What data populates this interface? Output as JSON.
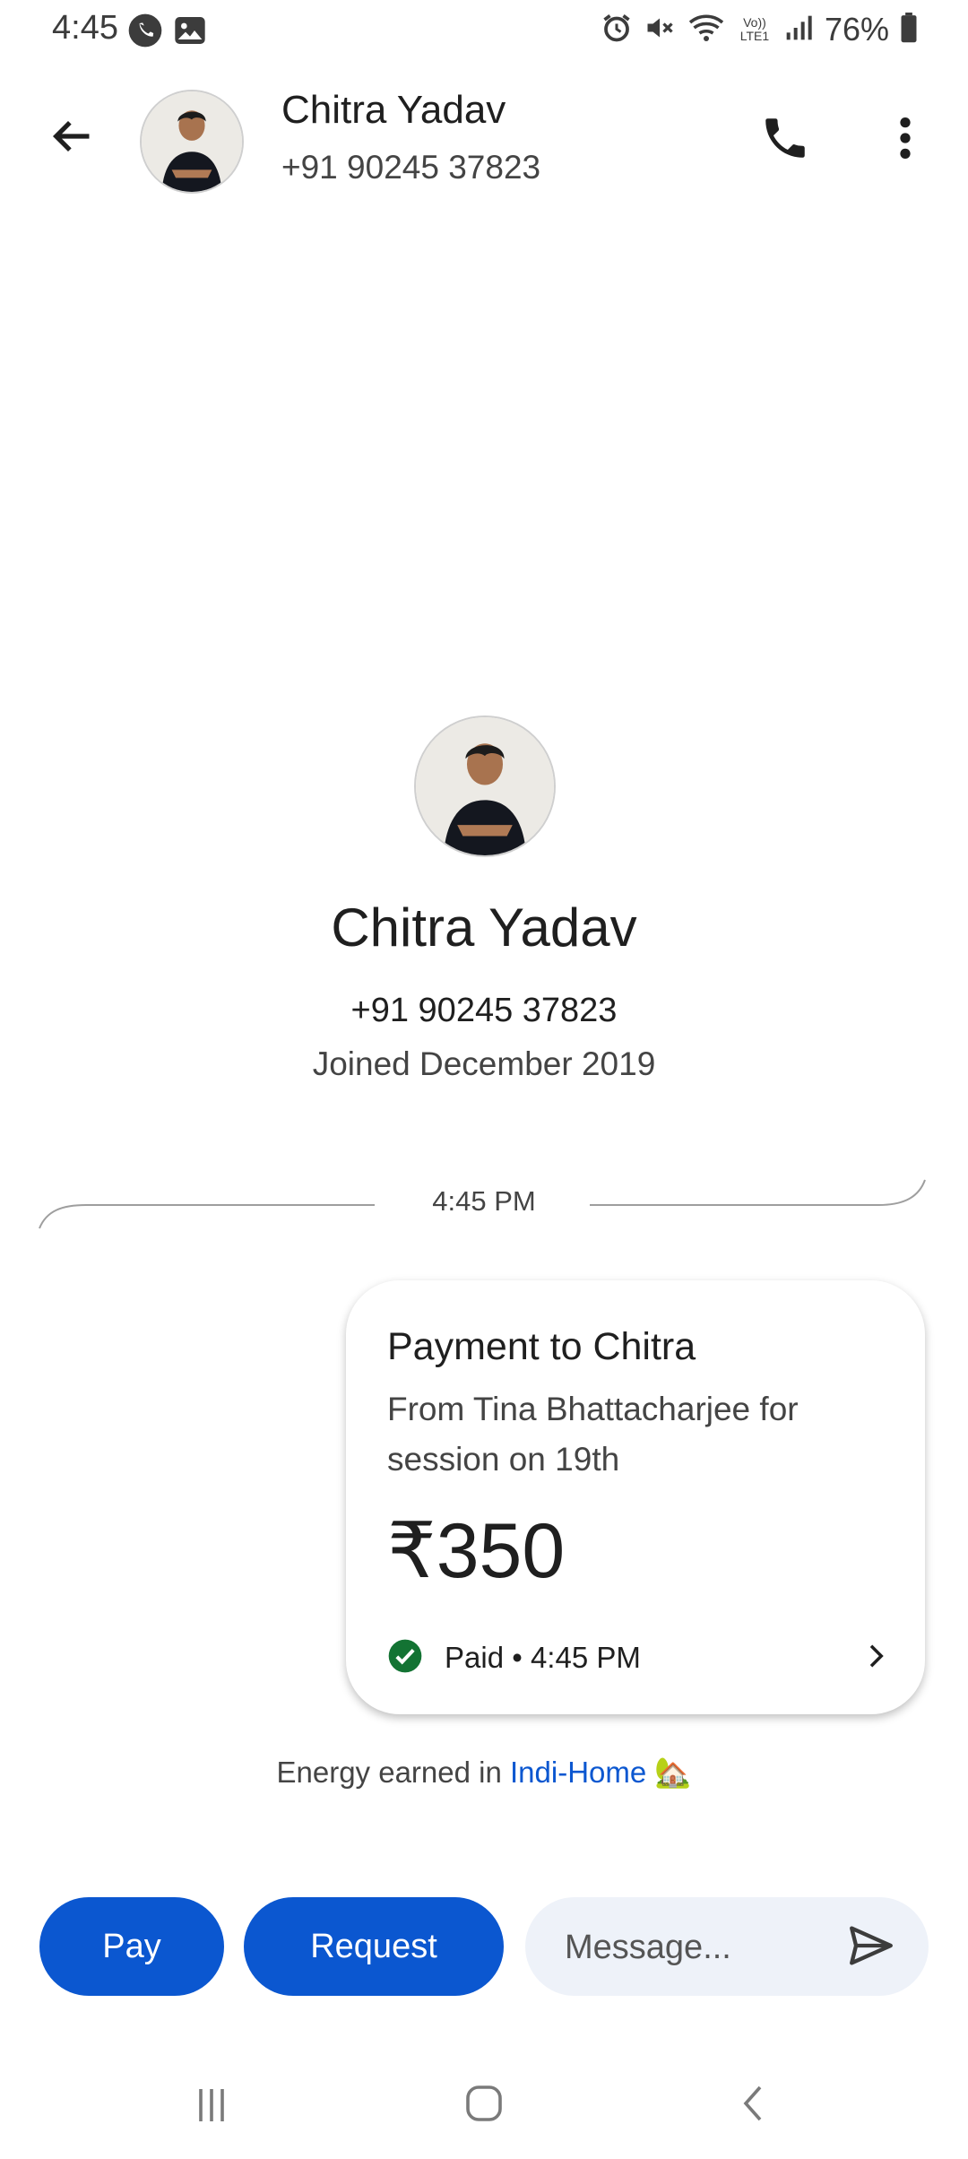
{
  "status_bar": {
    "time": "4:45",
    "battery": "76%",
    "icons": [
      "phone-call-icon",
      "image-icon",
      "alarm-icon",
      "mute-icon",
      "wifi-icon",
      "volte-icon",
      "signal-icon",
      "battery-icon"
    ],
    "volte_text": "Vo)) LTE1"
  },
  "header": {
    "name": "Chitra Yadav",
    "phone": "+91 90245 37823",
    "icons": [
      "back-arrow-icon",
      "call-icon",
      "more-vert-icon"
    ]
  },
  "profile": {
    "name": "Chitra Yadav",
    "phone": "+91 90245 37823",
    "joined": "Joined December 2019"
  },
  "conversation": {
    "timestamp": "4:45 PM",
    "payment": {
      "title": "Payment to Chitra",
      "description": "From Tina Bhattacharjee for session on 19th",
      "amount": "₹350",
      "status": "Paid • 4:45 PM",
      "status_color": "#137333"
    },
    "energy": {
      "prefix": "Energy earned in ",
      "link": "Indi-Home",
      "emoji": "🏡"
    }
  },
  "composer": {
    "pay_label": "Pay",
    "request_label": "Request",
    "message_placeholder": "Message..."
  },
  "colors": {
    "accent": "#0b57d0",
    "composer_bg": "#eef2f9",
    "success": "#137333"
  }
}
